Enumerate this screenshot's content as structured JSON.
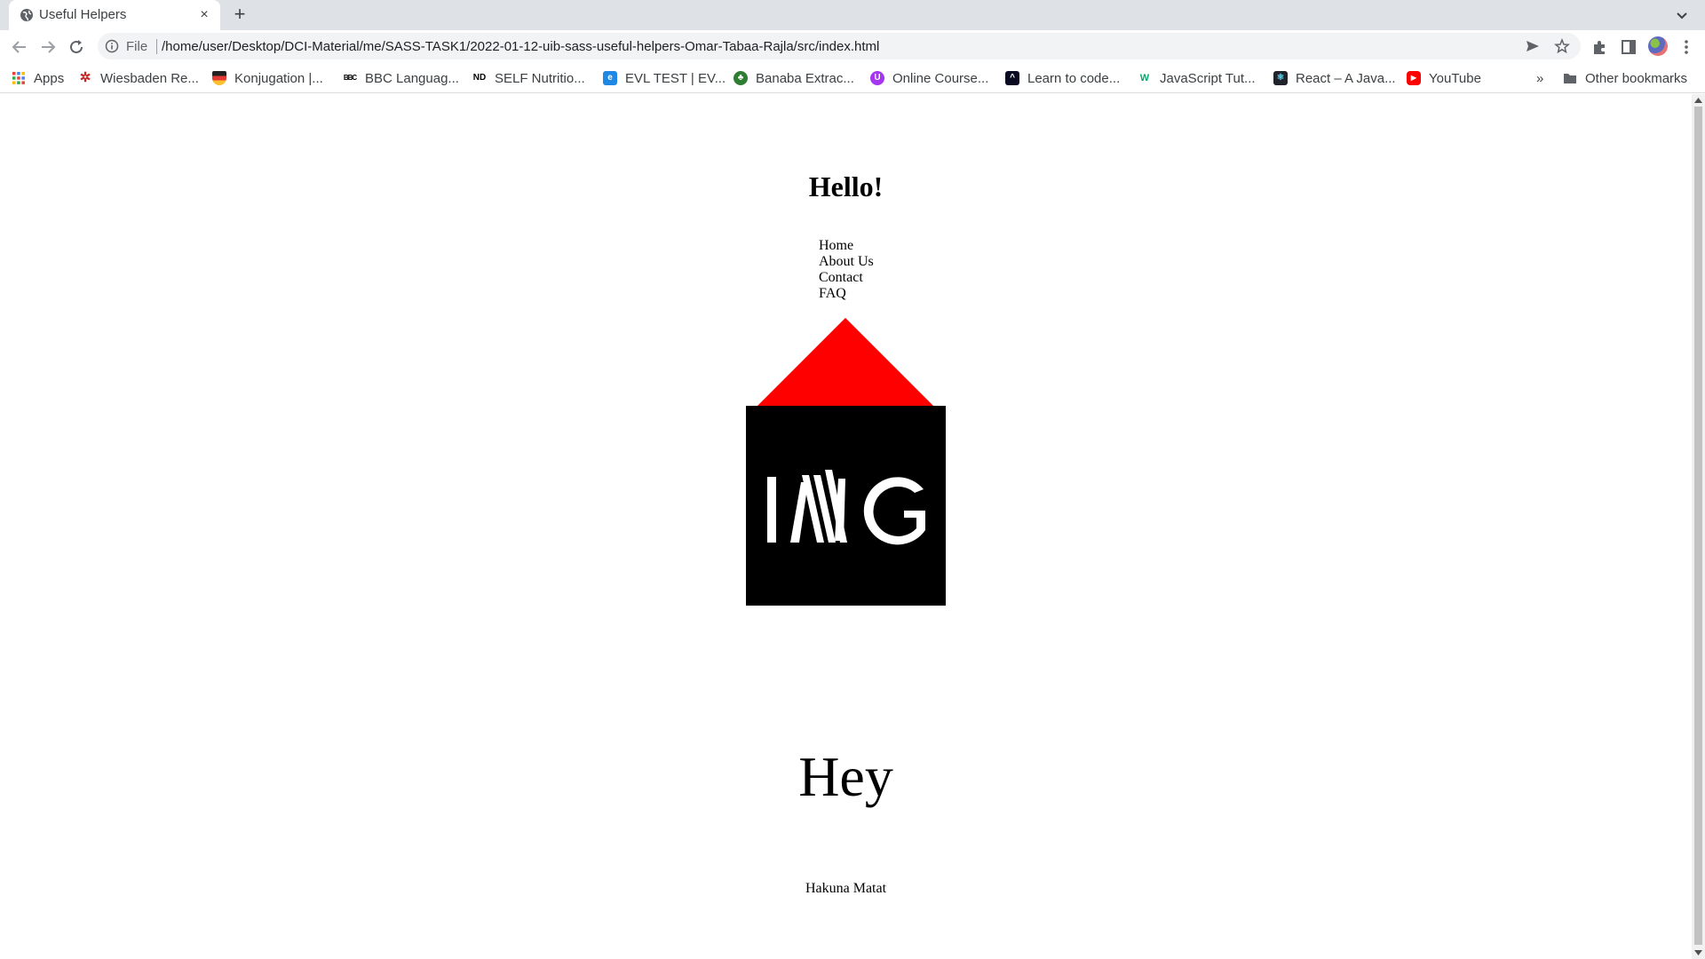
{
  "browser": {
    "tab_title": "Useful Helpers",
    "tab_close": "×",
    "new_tab": "+",
    "file_label": "File",
    "url": "/home/user/Desktop/DCI-Material/me/SASS-TASK1/2022-01-12-uib-sass-useful-helpers-Omar-Tabaa-Rajla/src/index.html",
    "bookmarks": [
      {
        "label": "Apps",
        "icon": "apps-grid-icon",
        "color": "#4285f4"
      },
      {
        "label": "Wiesbaden Re...",
        "icon": "wiesbaden-favicon",
        "color": "#c62828"
      },
      {
        "label": "Konjugation |...",
        "icon": "konjugation-favicon",
        "color": "#e53935"
      },
      {
        "label": "BBC Languag...",
        "icon": "bbc-favicon",
        "color": "#000000"
      },
      {
        "label": "SELF Nutritio...",
        "icon": "nd-favicon",
        "color": "#000000"
      },
      {
        "label": "EVL TEST | EV...",
        "icon": "evl-favicon",
        "color": "#1e88e5"
      },
      {
        "label": "Banaba Extrac...",
        "icon": "banaba-favicon",
        "color": "#2e7d32"
      },
      {
        "label": "Online Course...",
        "icon": "udemy-favicon",
        "color": "#a435f0"
      },
      {
        "label": "Learn to code...",
        "icon": "freecodecamp-favicon",
        "color": "#0a0a23"
      },
      {
        "label": "JavaScript Tut...",
        "icon": "w3-favicon",
        "color": "#04aa6d"
      },
      {
        "label": "React – A Java...",
        "icon": "react-favicon",
        "color": "#20232a"
      },
      {
        "label": "YouTube",
        "icon": "youtube-favicon",
        "color": "#ff0000"
      }
    ],
    "more_bookmarks": "»",
    "other_bookmarks": "Other bookmarks"
  },
  "page": {
    "heading": "Hello!",
    "nav": [
      "Home",
      "About Us",
      "Contact",
      "FAQ"
    ],
    "image_text": "IMG",
    "roof_color": "#ff0000",
    "big_text": "Hey",
    "footer_text": "Hakuna Matat"
  }
}
